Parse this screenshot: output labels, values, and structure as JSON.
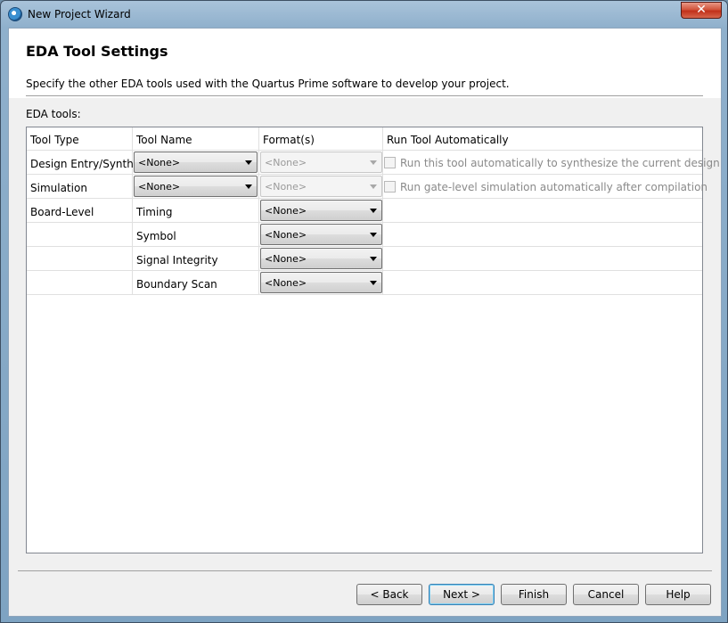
{
  "window": {
    "title": "New Project Wizard",
    "close_label": "✕"
  },
  "header": {
    "title": "EDA Tool Settings",
    "description": "Specify the other EDA tools used with the Quartus Prime software to develop your project."
  },
  "eda_label": "EDA tools:",
  "table": {
    "columns": [
      "Tool Type",
      "Tool Name",
      "Format(s)",
      "Run Tool Automatically"
    ],
    "rows": [
      {
        "tool_type": "Design Entry/Synth...",
        "tool_name": "<None>",
        "format": "<None>",
        "run_label": "Run this tool automatically to synthesize the current design"
      },
      {
        "tool_type": "Simulation",
        "tool_name": "<None>",
        "format": "<None>",
        "run_label": "Run gate-level simulation automatically after compilation"
      },
      {
        "tool_type": "Board-Level",
        "tool_name": "Timing",
        "format": "<None>"
      },
      {
        "tool_type": "",
        "tool_name": "Symbol",
        "format": "<None>"
      },
      {
        "tool_type": "",
        "tool_name": "Signal Integrity",
        "format": "<None>"
      },
      {
        "tool_type": "",
        "tool_name": "Boundary Scan",
        "format": "<None>"
      }
    ]
  },
  "buttons": {
    "back": "< Back",
    "next": "Next >",
    "finish": "Finish",
    "cancel": "Cancel",
    "help": "Help"
  },
  "colors": {
    "titlebar": "#8fb0cc",
    "close": "#c1301a",
    "default_button_border": "#3c7fb1"
  }
}
